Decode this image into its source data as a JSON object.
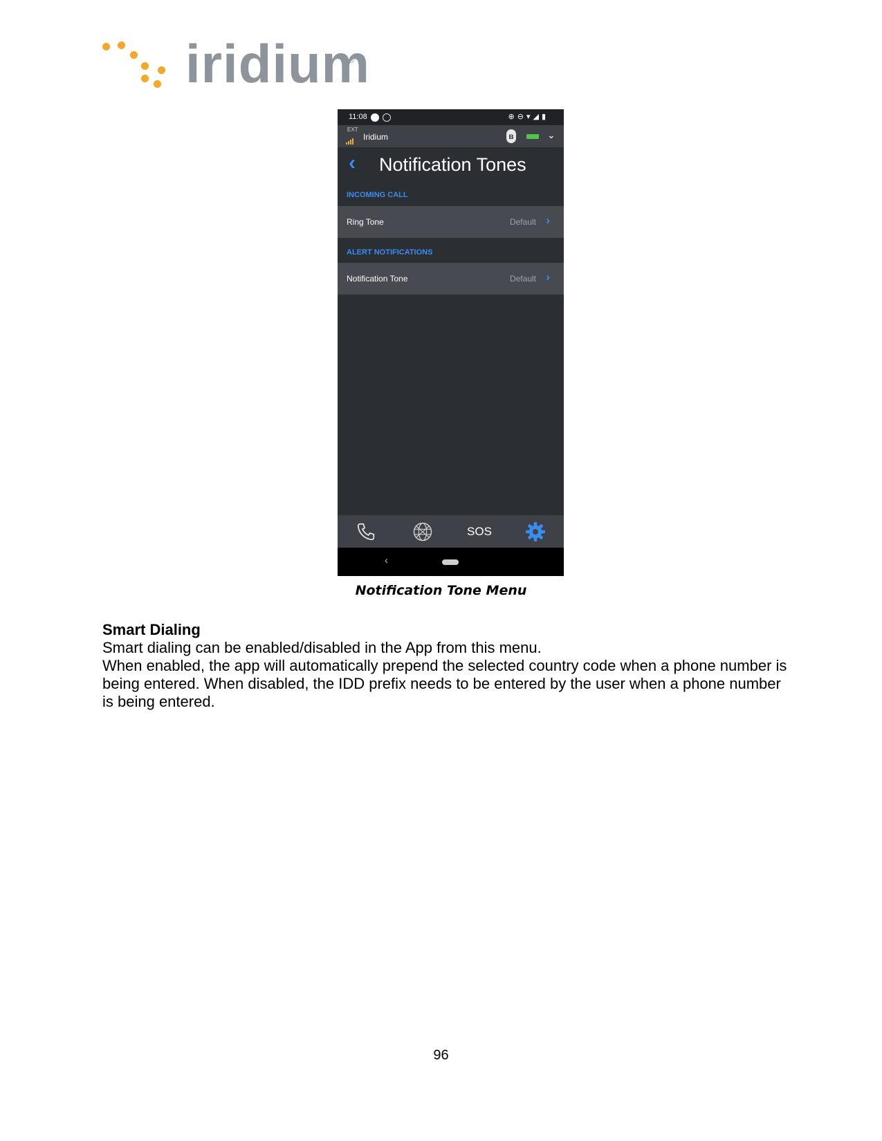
{
  "logo": {
    "text": "iridium",
    "mark": "®"
  },
  "phone": {
    "status_bar": {
      "time": "11:08",
      "icons": [
        "alarm-icon",
        "dnd-icon",
        "wifi-icon",
        "cell-icon",
        "battery-icon"
      ]
    },
    "ext_bar": {
      "ext_label": "EXT",
      "network": "Iridium",
      "icons": [
        "signal-icon",
        "bluetooth-icon",
        "battery-icon",
        "chevron-down-icon"
      ]
    },
    "title": "Notification Tones",
    "sections": [
      {
        "header": "INCOMING CALL",
        "row": {
          "label": "Ring Tone",
          "value": "Default"
        }
      },
      {
        "header": "ALERT NOTIFICATIONS",
        "row": {
          "label": "Notification Tone",
          "value": "Default"
        }
      }
    ],
    "tabs": [
      {
        "icon": "phone-icon"
      },
      {
        "icon": "globe-icon"
      },
      {
        "label": "SOS"
      },
      {
        "icon": "gear-icon",
        "active_color": "#3a8df0"
      }
    ]
  },
  "caption": "Notification Tone Menu",
  "section": {
    "heading": "Smart Dialing",
    "paragraphs": [
      "Smart dialing can be enabled/disabled in the App from this menu.",
      "When enabled, the app will automatically prepend the selected country code when a phone number is being entered. When disabled, the IDD prefix needs to be entered by the user when a phone number is being entered."
    ]
  },
  "page_number": "96"
}
